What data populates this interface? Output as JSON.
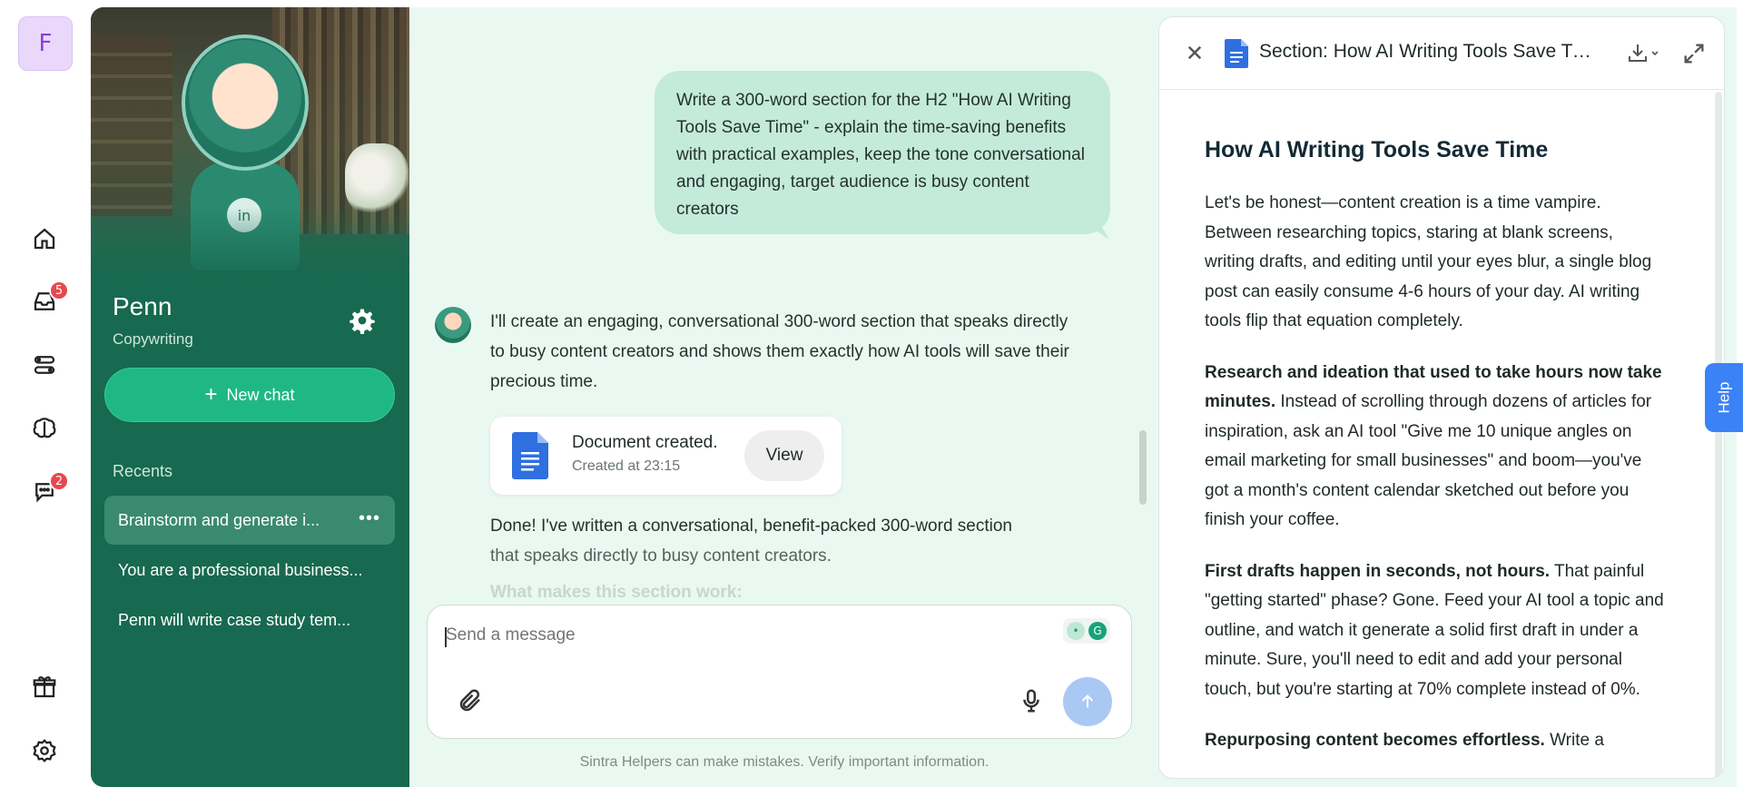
{
  "rail": {
    "user_initial": "F",
    "inbox_badge": "5",
    "chat_badge": "2"
  },
  "agent": {
    "name": "Penn",
    "role": "Copywriting",
    "new_chat_label": "New chat",
    "recents_label": "Recents",
    "recents": [
      {
        "label": "Brainstorm and generate i..."
      },
      {
        "label": "You are a professional business..."
      },
      {
        "label": "Penn will write case study tem..."
      }
    ],
    "accent": "#17694f"
  },
  "chat": {
    "user_message": "Write a 300-word section for the H2 \"How AI Writing Tools Save Time\" - explain the time-saving benefits with practical examples, keep the tone conversational and engaging, target audience is busy content creators",
    "bot_message": "I'll create an engaging, conversational 300-word section that speaks directly to busy content creators and shows them exactly how AI tools will save their precious time.",
    "doc_card": {
      "title": "Document created.",
      "time": "Created at 23:15",
      "view_label": "View"
    },
    "done_line1": "Done! I've written a conversational, benefit-packed 300-word section",
    "done_line2": "that speaks directly to busy content creators.",
    "faded_heading": "What makes this section work:",
    "composer_placeholder": "Send a message",
    "disclaimer": "Sintra Helpers can make mistakes. Verify important information."
  },
  "document": {
    "header_title": "Section: How AI Writing Tools Save Time",
    "heading": "How AI Writing Tools Save Time",
    "p1": "Let's be honest—content creation is a time vampire. Between researching topics, staring at blank screens, writing drafts, and editing until your eyes blur, a single blog post can easily consume 4-6 hours of your day. AI writing tools flip that equation completely.",
    "p2_bold": "Research and ideation that used to take hours now take minutes.",
    "p2_rest": " Instead of scrolling through dozens of articles for inspiration, ask an AI tool \"Give me 10 unique angles on email marketing for small businesses\" and boom—you've got a month's content calendar sketched out before you finish your coffee.",
    "p3_bold": "First drafts happen in seconds, not hours.",
    "p3_rest": " That painful \"getting started\" phase? Gone. Feed your AI tool a topic and outline, and watch it generate a solid first draft in under a minute. Sure, you'll need to edit and add your personal touch, but you're starting at 70% complete instead of 0%.",
    "p4_bold": "Repurposing content becomes effortless.",
    "p4_rest": " Write a"
  },
  "help_label": "Help"
}
